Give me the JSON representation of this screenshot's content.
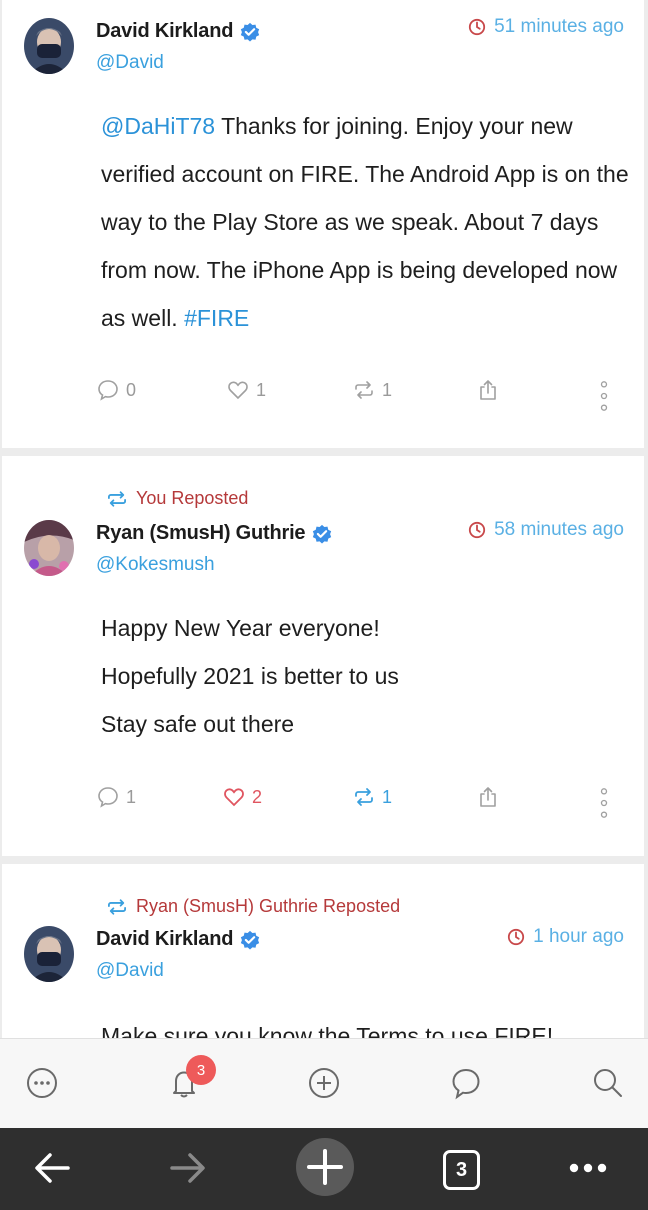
{
  "posts": [
    {
      "author": "David Kirkland",
      "handle": "@David",
      "time": "51 minutes ago",
      "text_parts": {
        "mention": "@DaHiT78",
        "body": " Thanks for joining. Enjoy your new verified account on FIRE. The Android App is on the way to the Play Store as we speak. About 7 days from now. The iPhone App is being developed now as well. ",
        "hashtag": "#FIRE"
      },
      "comments": "0",
      "likes": "1",
      "reposts": "1"
    },
    {
      "repost_label": "You Reposted",
      "author": "Ryan (SmusH) Guthrie",
      "handle": "@Kokesmush",
      "time": "58 minutes ago",
      "lines": [
        "Happy New Year everyone!",
        "Hopefully 2021 is better to us",
        "Stay safe out there"
      ],
      "comments": "1",
      "likes": "2",
      "reposts": "1"
    },
    {
      "repost_label": "Ryan (SmusH) Guthrie Reposted",
      "author": "David Kirkland",
      "handle": "@David",
      "time": "1 hour ago",
      "text": "Make sure you know the Terms to use FIRE!"
    }
  ],
  "tabbar": {
    "notifications_badge": "3"
  },
  "browser": {
    "tab_count": "3"
  },
  "colors": {
    "link": "#2b92d8",
    "repost_label": "#b5393a",
    "time": "#5ab0e4",
    "like_active": "#e05560",
    "badge": "#ee5a5a"
  },
  "icons": [
    "clock-icon",
    "verified-icon",
    "comment-icon",
    "heart-icon",
    "repost-icon",
    "share-icon",
    "more-vertical-icon",
    "more-circle-icon",
    "bell-icon",
    "add-circle-icon",
    "chat-icon",
    "search-icon",
    "back-arrow-icon",
    "forward-arrow-icon",
    "plus-icon",
    "more-horizontal-icon"
  ]
}
